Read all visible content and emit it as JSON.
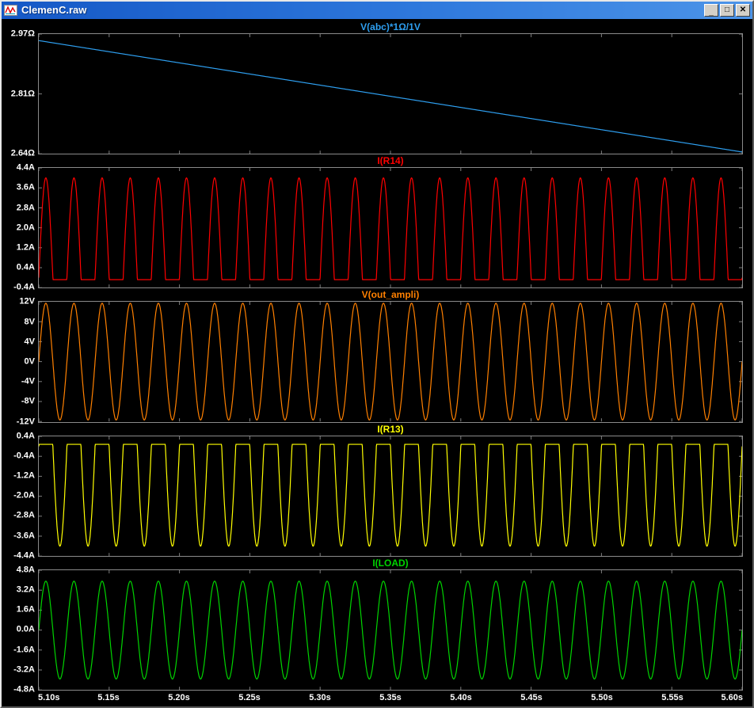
{
  "window": {
    "title": "ClemenC.raw",
    "buttons": {
      "minimize": "_",
      "maximize": "□",
      "close": "✕"
    }
  },
  "colors": {
    "plot_background": "#000000",
    "axis_text": "#ffffff",
    "pane_border": "#8a8a8a",
    "titlebar_blue": "#2e78dc"
  },
  "xaxis": {
    "range": [
      5.1,
      5.6
    ],
    "tick_labels": [
      "5.10s",
      "5.15s",
      "5.20s",
      "5.25s",
      "5.30s",
      "5.35s",
      "5.40s",
      "5.45s",
      "5.50s",
      "5.55s",
      "5.60s"
    ]
  },
  "chart_data": [
    {
      "type": "line",
      "title": "V(abc)*1Ω/1V",
      "color": "#2e9ff0",
      "ylim": [
        2.64,
        2.97
      ],
      "ytick_labels": [
        "2.97Ω",
        "2.81Ω",
        "2.64Ω"
      ],
      "signal": {
        "kind": "ramp",
        "start": 2.952,
        "end": 2.645
      }
    },
    {
      "type": "line",
      "title": "I(R14)",
      "color": "#ff0000",
      "ylim": [
        -0.4,
        4.4
      ],
      "ytick_labels": [
        "4.4A",
        "3.6A",
        "2.8A",
        "2.0A",
        "1.2A",
        "0.4A",
        "-0.4A"
      ],
      "signal": {
        "kind": "halfwave_pos",
        "amplitude": 4.0,
        "baseline": -0.08,
        "frequency": 50
      }
    },
    {
      "type": "line",
      "title": "V(out_ampli)",
      "color": "#ff8000",
      "ylim": [
        -12,
        12
      ],
      "ytick_labels": [
        "12V",
        "8V",
        "4V",
        "0V",
        "-4V",
        "-8V",
        "-12V"
      ],
      "signal": {
        "kind": "sine",
        "amplitude": 11.7,
        "frequency": 50
      }
    },
    {
      "type": "line",
      "title": "I(R13)",
      "color": "#ffff00",
      "ylim": [
        -4.4,
        0.4
      ],
      "ytick_labels": [
        "0.4A",
        "-0.4A",
        "-1.2A",
        "-2.0A",
        "-2.8A",
        "-3.6A",
        "-4.4A"
      ],
      "signal": {
        "kind": "halfwave_neg",
        "amplitude": 4.0,
        "baseline": 0.08,
        "frequency": 50
      }
    },
    {
      "type": "line",
      "title": "I(LOAD)",
      "color": "#00d400",
      "ylim": [
        -4.8,
        4.8
      ],
      "ytick_labels": [
        "4.8A",
        "3.2A",
        "1.6A",
        "0.0A",
        "-1.6A",
        "-3.2A",
        "-4.8A"
      ],
      "signal": {
        "kind": "sine",
        "amplitude": 3.92,
        "frequency": 50
      }
    }
  ]
}
